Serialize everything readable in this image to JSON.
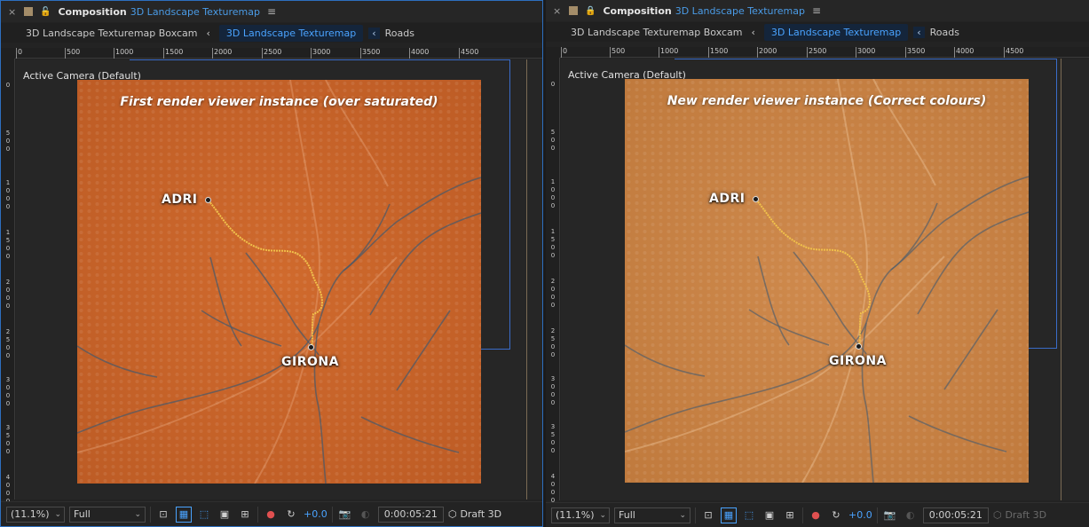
{
  "colors": {
    "accent": "#4a9be6",
    "saturated_base": "#c8642a",
    "correct_base": "#c98346",
    "route": "#f1c24b",
    "river": "#4c5a68"
  },
  "panels": [
    {
      "header": {
        "close": "×",
        "lock": "🔓",
        "comp_label": "Composition",
        "comp_name": "3D Landscape Texturemap",
        "menu": "≡"
      },
      "tabs": [
        "3D Landscape Texturemap Boxcam",
        "3D Landscape Texturemap",
        "Roads"
      ],
      "ruler_labels": [
        "0",
        "500",
        "1000",
        "1500",
        "2000",
        "2500",
        "3000",
        "3500",
        "4000",
        "4500"
      ],
      "vruler_labels": [
        "0",
        "5\n0\n0",
        "1\n0\n0\n0",
        "1\n5\n0\n0",
        "2\n0\n0\n0",
        "2\n5\n0\n0",
        "3\n0\n0\n0",
        "3\n5\n0\n0",
        "4\n0\n0\n0"
      ],
      "camera": "Active Camera (Default)",
      "map_title": "First render viewer instance (over saturated)",
      "cities": [
        "ADRI",
        "GIRONA"
      ],
      "footer": {
        "zoom": "(11.1%)",
        "resolution": "Full",
        "exposure": "+0.0",
        "timecode": "0:00:05:21",
        "renderer": "Draft 3D"
      }
    },
    {
      "header": {
        "close": "×",
        "lock": "🔒",
        "comp_label": "Composition",
        "comp_name": "3D Landscape Texturemap",
        "menu": "≡"
      },
      "tabs": [
        "3D Landscape Texturemap Boxcam",
        "3D Landscape Texturemap",
        "Roads"
      ],
      "ruler_labels": [
        "0",
        "500",
        "1000",
        "1500",
        "2000",
        "2500",
        "3000",
        "3500",
        "4000",
        "4500"
      ],
      "vruler_labels": [
        "0",
        "5\n0\n0",
        "1\n0\n0\n0",
        "1\n5\n0\n0",
        "2\n0\n0\n0",
        "2\n5\n0\n0",
        "3\n0\n0\n0",
        "3\n5\n0\n0",
        "4\n0\n0\n0"
      ],
      "camera": "Active Camera (Default)",
      "map_title": "New render viewer instance (Correct colours)",
      "cities": [
        "ADRI",
        "GIRONA"
      ],
      "footer": {
        "zoom": "(11.1%)",
        "resolution": "Full",
        "exposure": "+0.0",
        "timecode": "0:00:05:21",
        "renderer": "Draft 3D"
      }
    }
  ]
}
